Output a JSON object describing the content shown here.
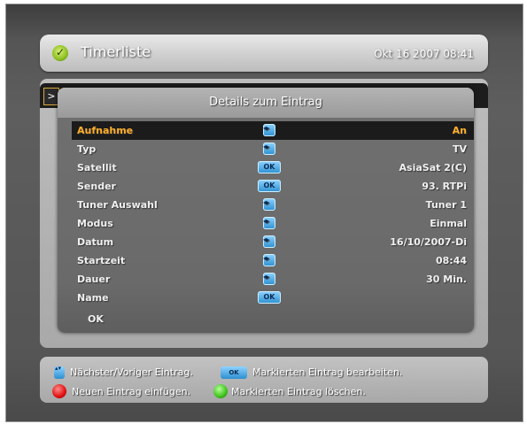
{
  "header": {
    "title": "Timerliste",
    "datetime": "Okt 16 2007 08:41"
  },
  "list": {
    "selector_arrow": ">"
  },
  "dialog": {
    "title": "Details zum Eintrag",
    "rows": [
      {
        "label": "Aufnahme",
        "control": "arrows",
        "value": "An",
        "selected": true
      },
      {
        "label": "Typ",
        "control": "arrows",
        "value": "TV"
      },
      {
        "label": "Satellit",
        "control": "ok",
        "value": "AsiaSat 2(C)"
      },
      {
        "label": "Sender",
        "control": "ok",
        "value": "93. RTPi"
      },
      {
        "label": "Tuner Auswahl",
        "control": "arrows",
        "value": "Tuner 1"
      },
      {
        "label": "Modus",
        "control": "arrows",
        "value": "Einmal"
      },
      {
        "label": "Datum",
        "control": "arrows",
        "value": "16/10/2007-Di"
      },
      {
        "label": "Startzeit",
        "control": "arrows",
        "value": "08:44"
      },
      {
        "label": "Dauer",
        "control": "arrows",
        "value": "30 Min."
      },
      {
        "label": "Name",
        "control": "ok",
        "value": ""
      }
    ],
    "ok_label": "OK",
    "ok_key_label": "OK"
  },
  "footer": {
    "next_prev": "Nächster/Voriger Eintrag.",
    "ok_key": "OK",
    "edit": "Markierten Eintrag bearbeiten.",
    "add": "Neuen Eintrag einfügen.",
    "delete": "Markierten Eintrag löschen."
  },
  "colors": {
    "selected_text": "#ffae2a",
    "key_blue": "#2b8fd0",
    "key_red": "#e01010",
    "key_green": "#3fc21c"
  }
}
